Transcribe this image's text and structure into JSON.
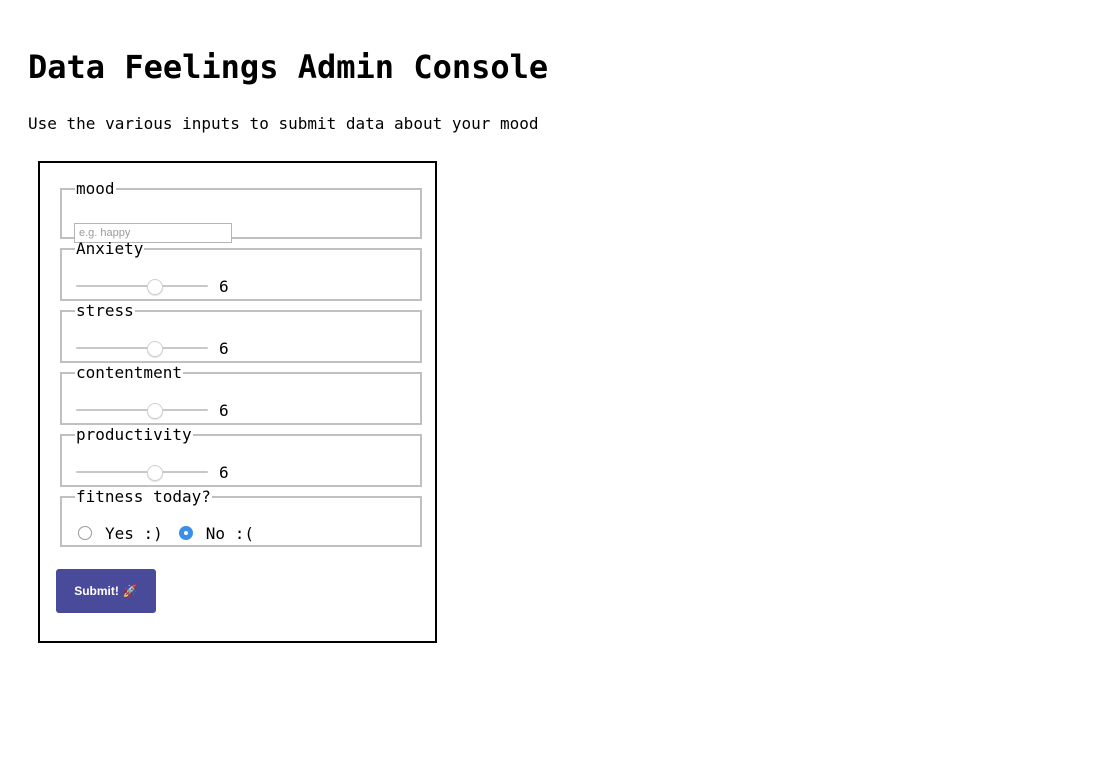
{
  "page": {
    "title": "Data Feelings Admin Console",
    "subtitle": "Use the various inputs to submit data about your mood"
  },
  "form": {
    "mood": {
      "legend": "mood",
      "placeholder": "e.g. happy",
      "value": ""
    },
    "sliders": [
      {
        "legend": "Anxiety",
        "value": "6",
        "min": 0,
        "max": 10
      },
      {
        "legend": "stress",
        "value": "6",
        "min": 0,
        "max": 10
      },
      {
        "legend": "contentment",
        "value": "6",
        "min": 0,
        "max": 10
      },
      {
        "legend": "productivity",
        "value": "6",
        "min": 0,
        "max": 10
      }
    ],
    "fitness": {
      "legend": "fitness today?",
      "options": [
        {
          "label": "Yes :)",
          "checked": false
        },
        {
          "label": "No :(",
          "checked": true
        }
      ]
    },
    "submit": {
      "label": "Submit!",
      "icon": "rocket-icon",
      "icon_glyph": "🚀",
      "color": "#4a4a9b"
    }
  },
  "colors": {
    "radio_checked": "#3b8fea",
    "fieldset_border": "#c0c0c0"
  }
}
